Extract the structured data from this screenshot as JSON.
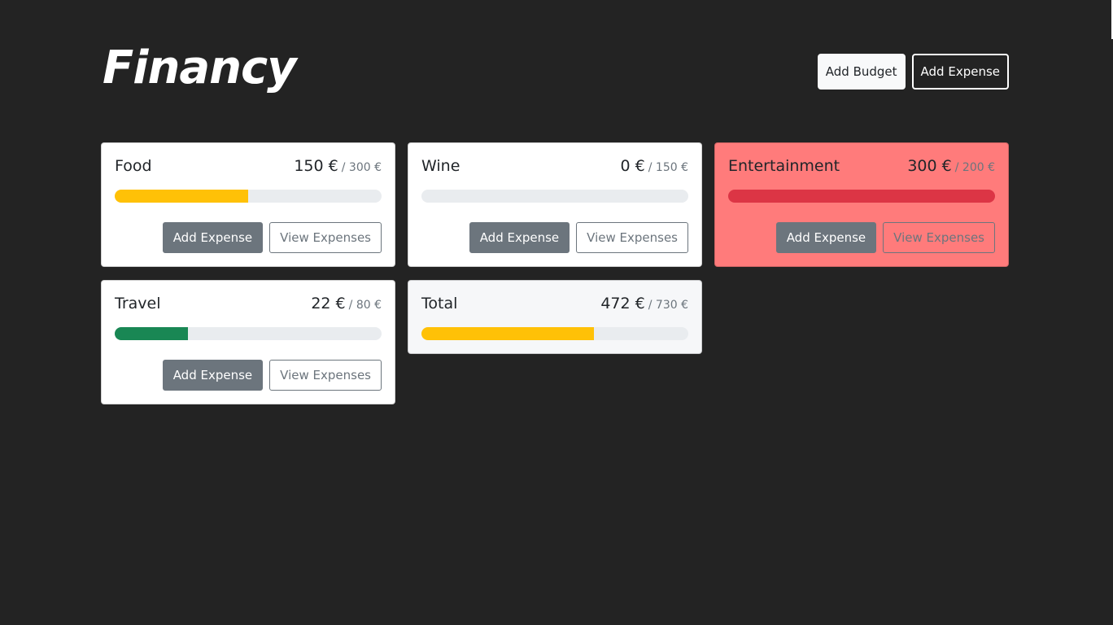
{
  "app": {
    "logo": "Financy"
  },
  "header": {
    "add_budget_label": "Add Budget",
    "add_expense_label": "Add Expense"
  },
  "budgets": [
    {
      "name": "Food",
      "amount": "150 €",
      "max": "/ 300 €",
      "progress_fraction": 0.5,
      "bar_color": "#ffc107",
      "card_color": "#ffffff",
      "add_label": "Add Expense",
      "view_label": "View Expenses"
    },
    {
      "name": "Wine",
      "amount": "0 €",
      "max": "/ 150 €",
      "progress_fraction": 0.0,
      "bar_color": "#0d6efd",
      "card_color": "#ffffff",
      "add_label": "Add Expense",
      "view_label": "View Expenses"
    },
    {
      "name": "Entertainment",
      "amount": "300 €",
      "max": "/ 200 €",
      "progress_fraction": 1.0,
      "bar_color": "#dc3545",
      "card_color": "#ff7b7b",
      "add_label": "Add Expense",
      "view_label": "View Expenses"
    },
    {
      "name": "Travel",
      "amount": "22 €",
      "max": "/ 80 €",
      "progress_fraction": 0.275,
      "bar_color": "#198754",
      "card_color": "#ffffff",
      "add_label": "Add Expense",
      "view_label": "View Expenses"
    }
  ],
  "total": {
    "name": "Total",
    "amount": "472 €",
    "max": "/ 730 €",
    "progress_fraction": 0.6466,
    "bar_color": "#ffc107",
    "card_color": "#f6f7f9"
  }
}
